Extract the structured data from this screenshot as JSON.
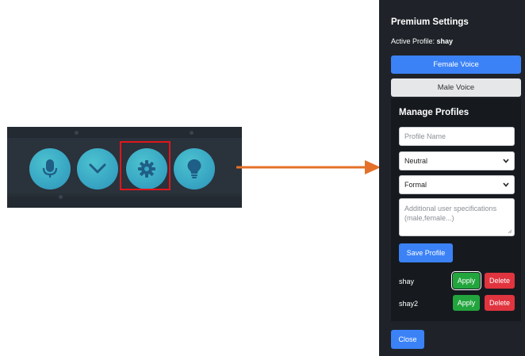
{
  "toolbar": {
    "buttons": [
      {
        "icon": "microphone-icon"
      },
      {
        "icon": "chevron-down-icon"
      },
      {
        "icon": "gear-icon",
        "highlighted": true
      },
      {
        "icon": "lightbulb-icon"
      }
    ],
    "button_color": "#3aa9c5",
    "highlight_color": "#e0161b"
  },
  "arrow": {
    "color": "#e4702a"
  },
  "panel": {
    "title": "Premium Settings",
    "active_profile_label": "Active Profile:",
    "active_profile_value": "shay",
    "female_voice_label": "Female Voice",
    "male_voice_label": "Male Voice",
    "manage": {
      "title": "Manage Profiles",
      "profile_name_placeholder": "Profile Name",
      "tone_selected": "Neutral",
      "style_selected": "Formal",
      "specs_placeholder": "Additional user specifications (male,female...)",
      "save_label": "Save Profile",
      "profiles": [
        {
          "name": "shay",
          "apply_label": "Apply",
          "delete_label": "Delete"
        },
        {
          "name": "shay2",
          "apply_label": "Apply",
          "delete_label": "Delete"
        }
      ]
    },
    "close_label": "Close",
    "colors": {
      "primary": "#3b82f6",
      "apply": "#22a53d",
      "delete": "#e0343f",
      "background": "#1f2329"
    }
  }
}
